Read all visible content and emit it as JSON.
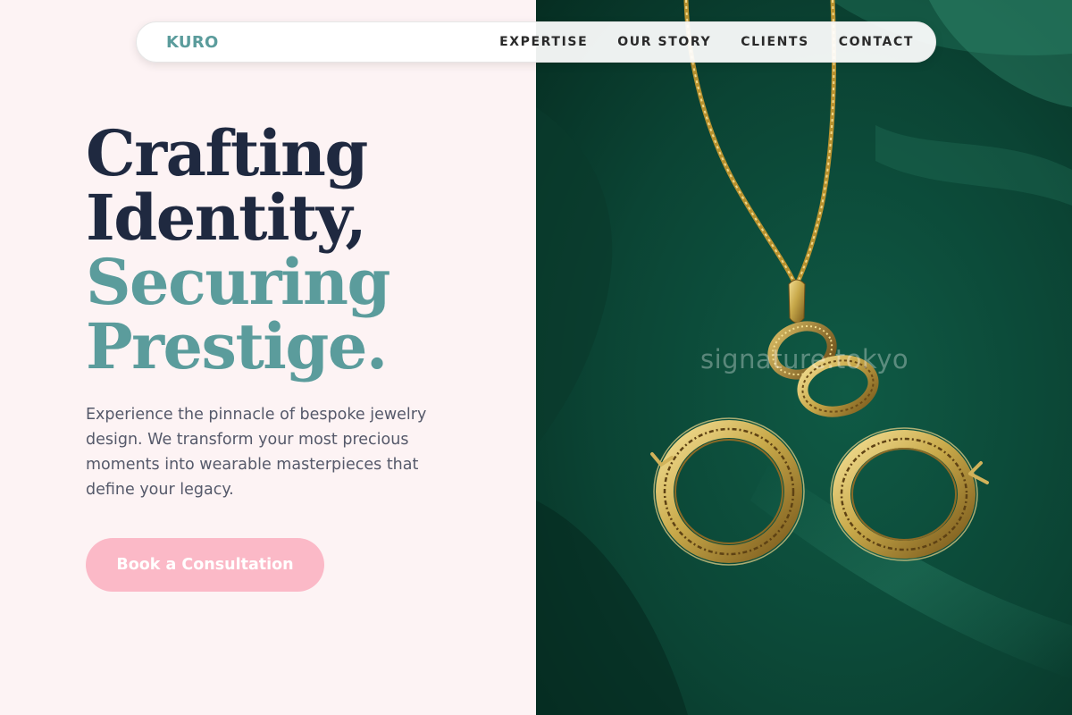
{
  "nav": {
    "logo": "KURO",
    "links": [
      "EXPERTISE",
      "OUR STORY",
      "CLIENTS",
      "CONTACT"
    ]
  },
  "hero": {
    "headline": [
      "Crafting",
      "Identity,",
      "Securing",
      "Prestige."
    ],
    "description": "Experience the pinnacle of bespoke jewelry design. We transform your most precious moments into wearable masterpieces that define your legacy.",
    "cta_label": "Book a Consultation"
  },
  "image": {
    "watermark": "signature.tokyo",
    "alt": "gold chain pendant and two gold Greek key hoop earrings on dark green satin"
  },
  "colors": {
    "page_background": "#fdf3f4",
    "heading_dark": "#1f2940",
    "accent_teal": "#5b9c9c",
    "cta_pink": "#fbb9c7",
    "satin_green": "#0c3d30",
    "gold": "#c8a94a"
  }
}
